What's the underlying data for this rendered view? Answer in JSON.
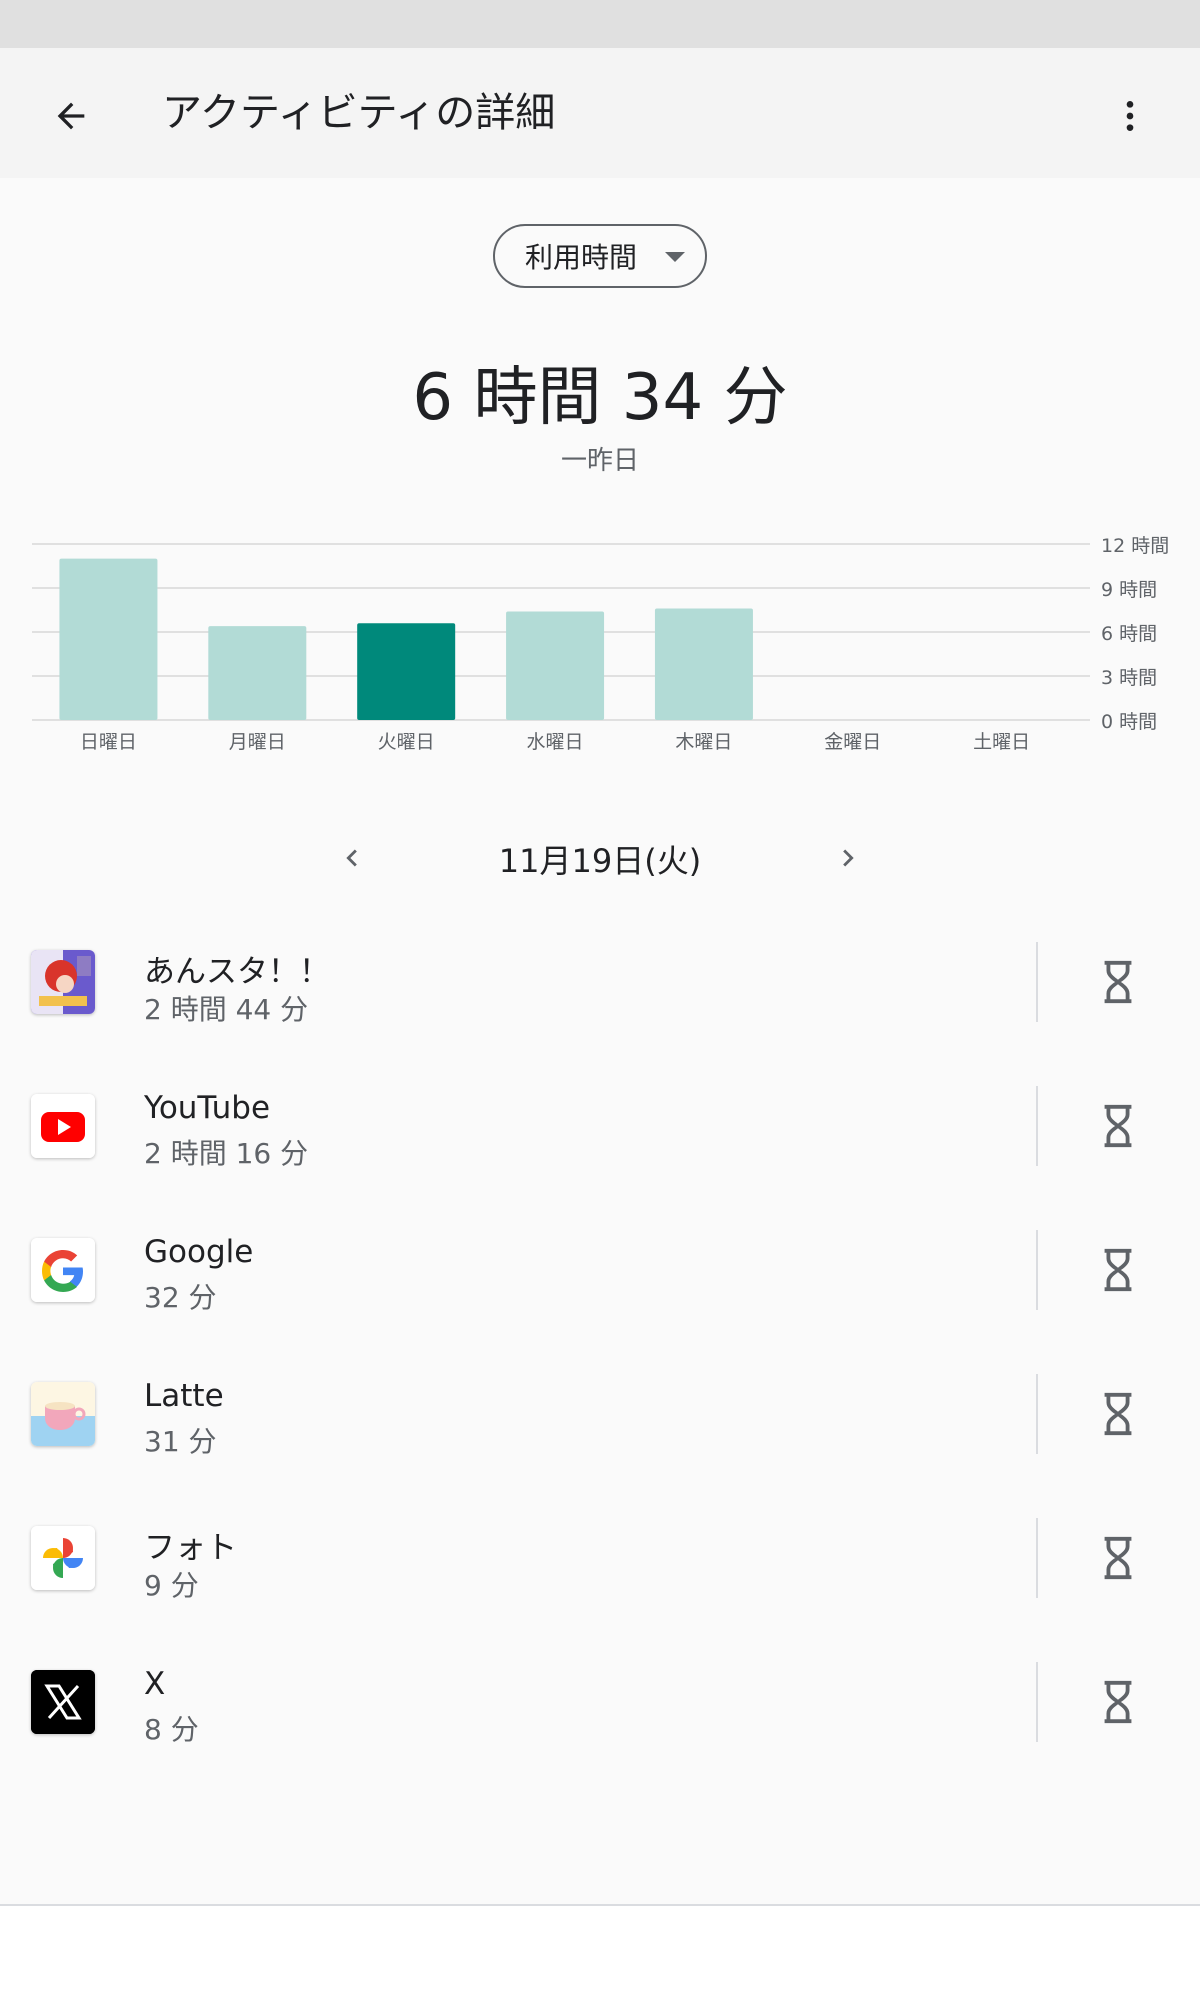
{
  "header": {
    "title": "アクティビティの詳細",
    "back_icon": "arrow-back-icon",
    "more_icon": "more-vert-icon"
  },
  "metric_selector": {
    "selected": "利用時間"
  },
  "summary": {
    "total": "6 時間 34 分",
    "label": "一昨日"
  },
  "chart_data": {
    "type": "bar",
    "categories": [
      "日曜日",
      "月曜日",
      "火曜日",
      "水曜日",
      "木曜日",
      "金曜日",
      "土曜日"
    ],
    "values": [
      11.0,
      6.4,
      6.6,
      7.4,
      7.6,
      0,
      0
    ],
    "selected_index": 2,
    "y_ticks": [
      "0 時間",
      "3 時間",
      "6 時間",
      "9 時間",
      "12 時間"
    ],
    "ylim": [
      0,
      12
    ],
    "colors": {
      "bar": "#b2dbd6",
      "selected": "#00897b",
      "grid": "#e0e0e0"
    }
  },
  "date_nav": {
    "label": "11月19日(火)",
    "prev_icon": "chevron-left-icon",
    "next_icon": "chevron-right-icon"
  },
  "apps": [
    {
      "name": "あんスタ！！",
      "time": "2 時間 44 分",
      "icon": "enstars-icon"
    },
    {
      "name": "YouTube",
      "time": "2 時間 16 分",
      "icon": "youtube-icon"
    },
    {
      "name": "Google",
      "time": "32 分",
      "icon": "google-icon"
    },
    {
      "name": "Latte",
      "time": "31 分",
      "icon": "latte-icon"
    },
    {
      "name": "フォト",
      "time": "9 分",
      "icon": "photos-icon"
    },
    {
      "name": "X",
      "time": "8 分",
      "icon": "x-icon"
    }
  ],
  "timer_icon": "hourglass-icon"
}
